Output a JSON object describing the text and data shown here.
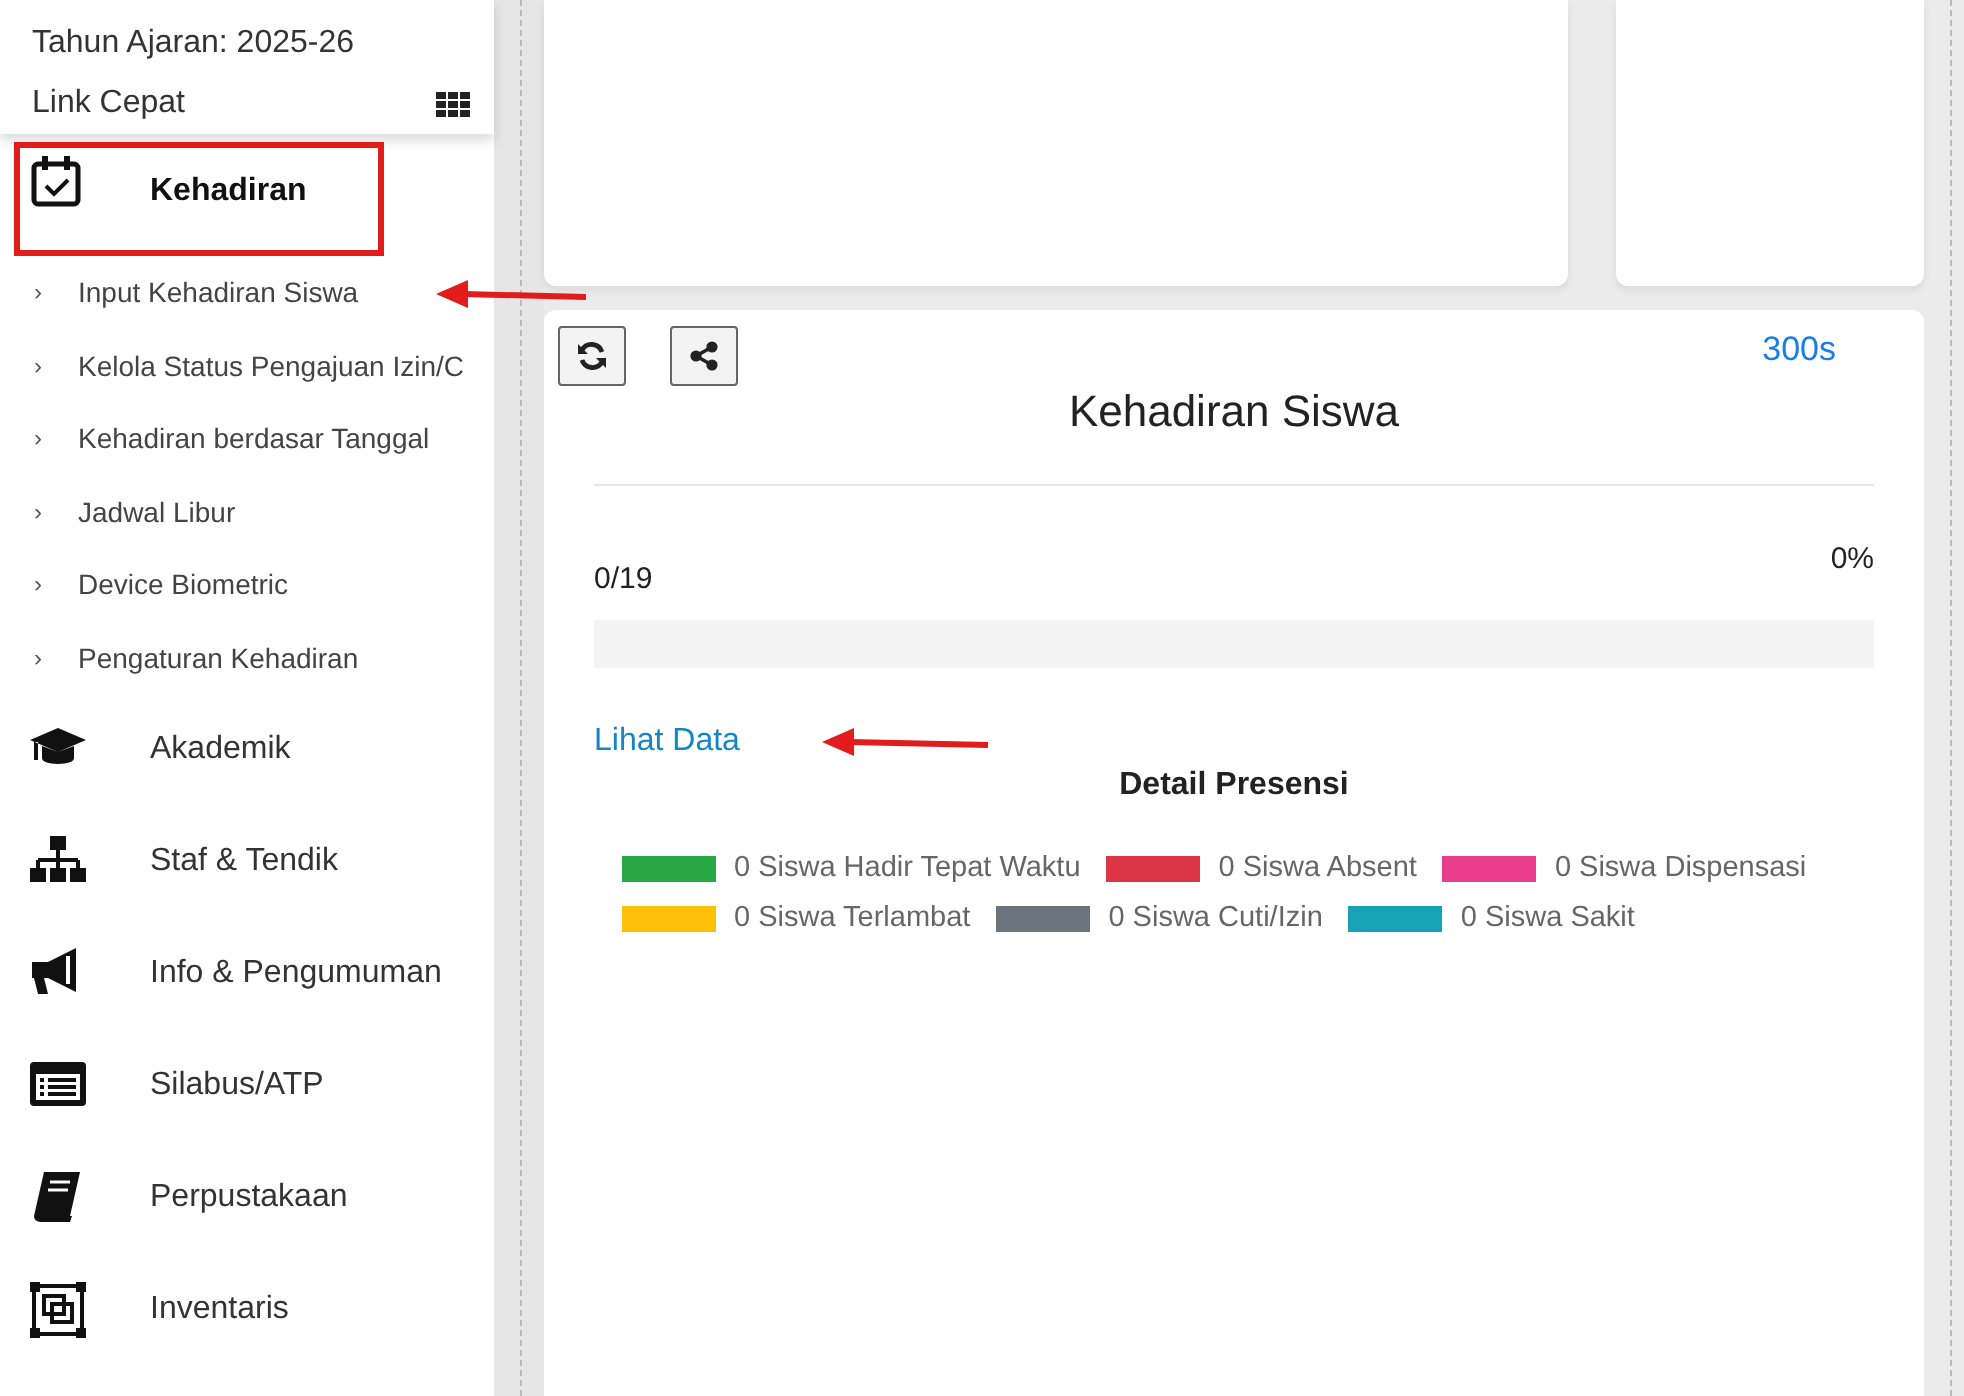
{
  "sidebar": {
    "academic_year": "Tahun Ajaran: 2025-26",
    "quick_link": "Link Cepat",
    "sections": [
      {
        "label": "Kehadiran",
        "expanded": true,
        "highlighted": true,
        "children": [
          {
            "marker": "›",
            "label": "Input Kehadiran Siswa",
            "annotated": true
          },
          {
            "marker": "›",
            "label": "Kelola Status Pengajuan Izin/C",
            "annotated": false
          },
          {
            "marker": "›",
            "label": "Kehadiran berdasar Tanggal",
            "annotated": false
          },
          {
            "marker": "›",
            "label": "Jadwal Libur",
            "annotated": false
          },
          {
            "marker": "›",
            "label": "Device Biometric",
            "annotated": false
          },
          {
            "marker": "›",
            "label": "Pengaturan Kehadiran",
            "annotated": false
          }
        ]
      },
      {
        "label": "Akademik",
        "expanded": false,
        "highlighted": false
      },
      {
        "label": "Staf & Tendik",
        "expanded": false,
        "highlighted": false
      },
      {
        "label": "Info & Pengumuman",
        "expanded": false,
        "highlighted": false
      },
      {
        "label": "Silabus/ATP",
        "expanded": false,
        "highlighted": false
      },
      {
        "label": "Perpustakaan",
        "expanded": false,
        "highlighted": false
      },
      {
        "label": "Inventaris",
        "expanded": false,
        "highlighted": false
      }
    ]
  },
  "attendance_card": {
    "timer": "300s",
    "title": "Kehadiran Siswa",
    "count": "0/19",
    "percent": "0%",
    "level": 0,
    "link": {
      "label": "Lihat Data",
      "annotated": true
    },
    "detail_title": "Detail Presensi",
    "legend": [
      {
        "label": "0 Siswa Hadir Tepat Waktu",
        "color": "#28a745"
      },
      {
        "label": "0 Siswa Absent",
        "color": "#dc3545"
      },
      {
        "label": "0 Siswa Dispensasi",
        "color": "#e83e8c"
      },
      {
        "label": "0 Siswa Terlambat",
        "color": "#ffc107"
      },
      {
        "label": "0 Siswa Cuti/Izin",
        "color": "#6c757d"
      },
      {
        "label": "0 Siswa Sakit",
        "color": "#17a2b8"
      }
    ]
  }
}
